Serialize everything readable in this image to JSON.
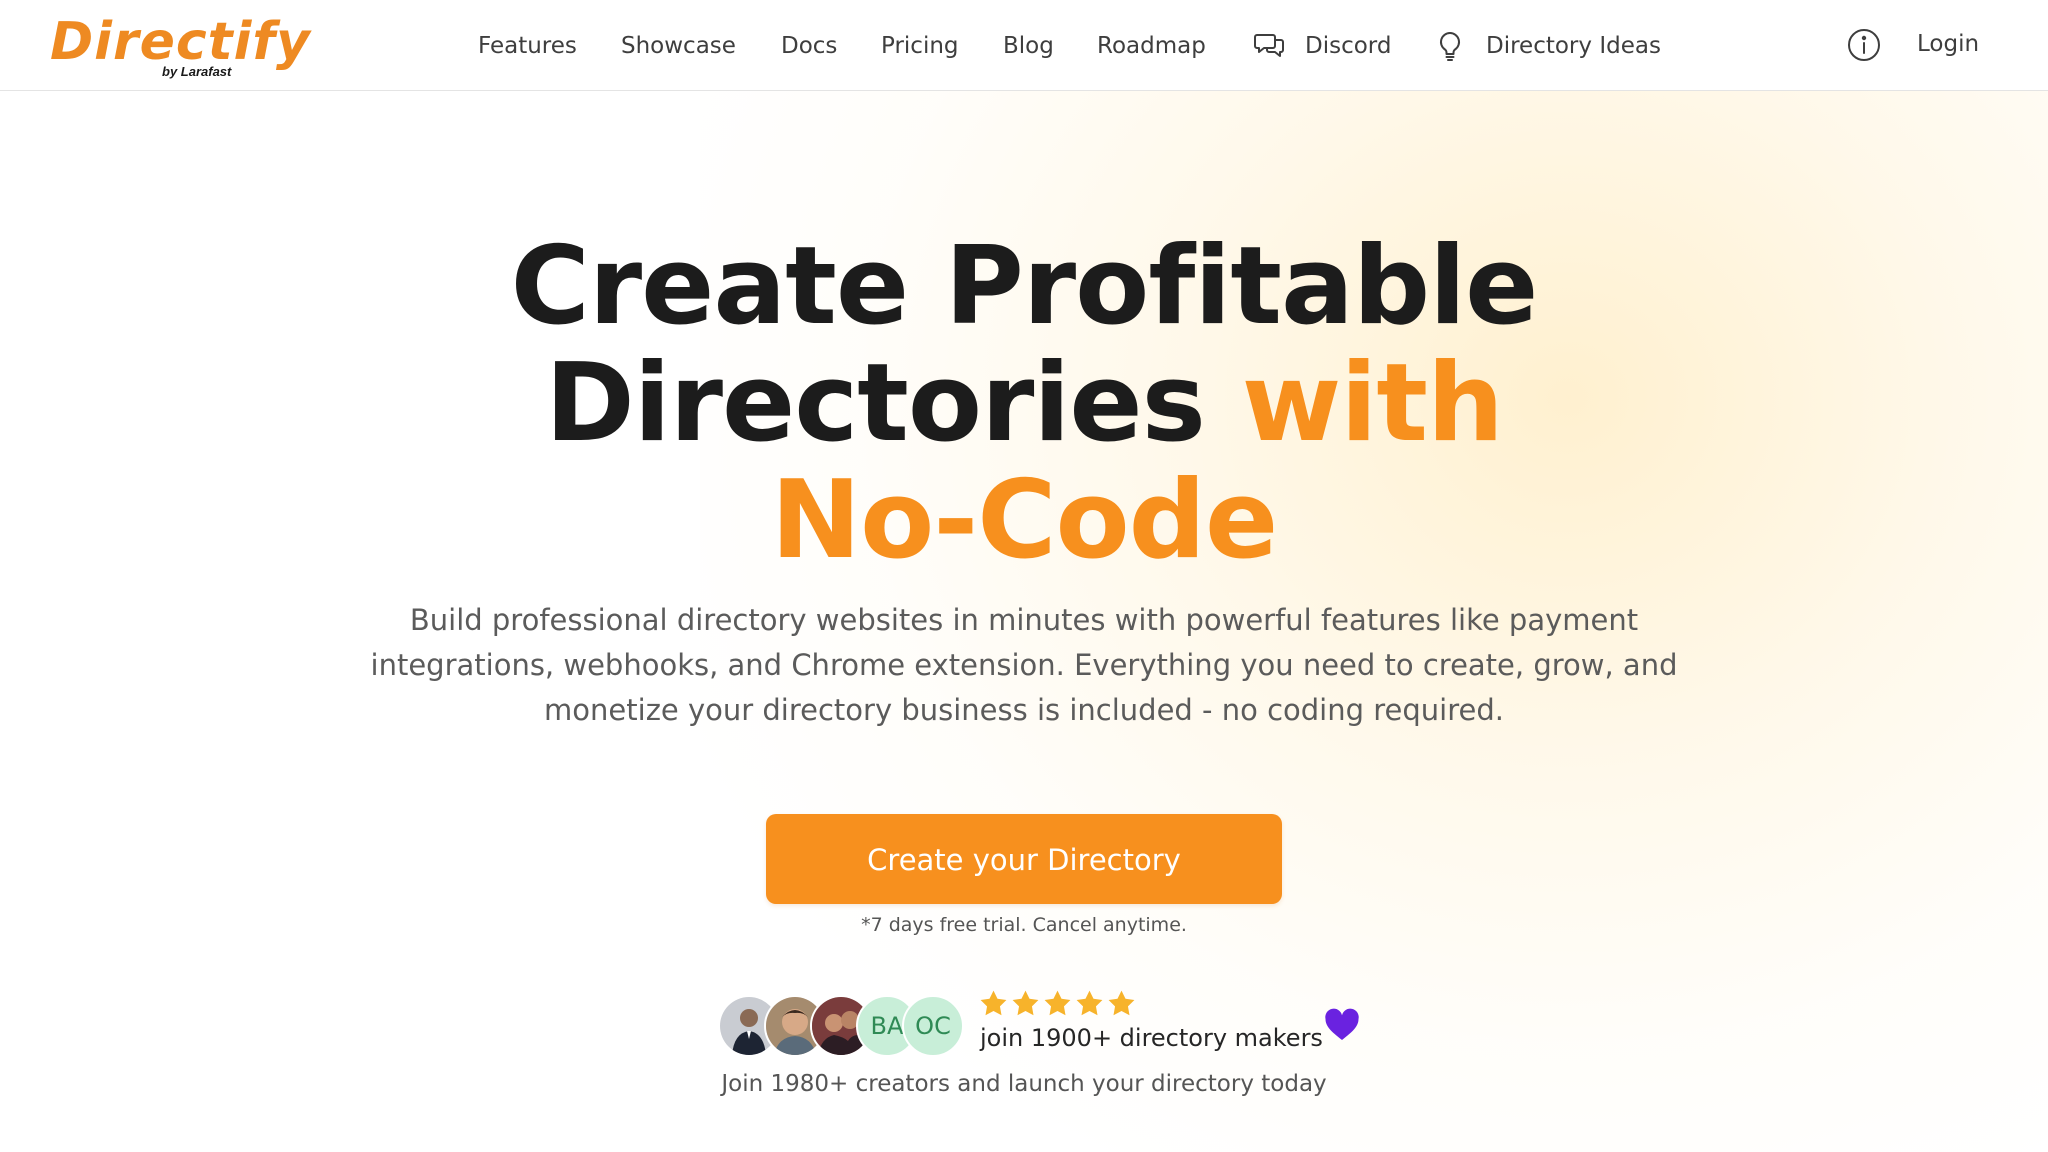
{
  "brand": {
    "name": "Directify",
    "tagline": "by Larafast",
    "accent_color": "#f7901e",
    "logo_color": "#ee8a22"
  },
  "nav": {
    "links": [
      {
        "label": "Features"
      },
      {
        "label": "Showcase"
      },
      {
        "label": "Docs"
      },
      {
        "label": "Pricing"
      },
      {
        "label": "Blog"
      },
      {
        "label": "Roadmap"
      },
      {
        "label": "Discord",
        "icon": "chat-bubbles-icon"
      },
      {
        "label": "Directory Ideas",
        "icon": "lightbulb-icon"
      }
    ],
    "info_icon": "info-icon",
    "login_label": "Login"
  },
  "hero": {
    "headline_line1": "Create Profitable",
    "headline_line2_dark": "Directories",
    "headline_line2_accent": "with",
    "headline_line3_accent": "No-Code",
    "subtext": "Build professional directory websites in minutes with powerful features like payment integrations, webhooks, and Chrome extension. Everything you need to create, grow, and monetize your directory business is included - no coding required.",
    "cta_label": "Create your Directory",
    "trial_note": "*7 days free trial. Cancel anytime."
  },
  "social_proof": {
    "avatars": [
      {
        "type": "photo",
        "icon": "user-photo-1"
      },
      {
        "type": "photo",
        "icon": "user-photo-2"
      },
      {
        "type": "photo",
        "icon": "user-photo-3"
      },
      {
        "type": "initials",
        "initials": "BA"
      },
      {
        "type": "initials",
        "initials": "OC"
      }
    ],
    "rating": 5,
    "star_color": "#f7b32b",
    "makers_text": "join 1900+ directory makers",
    "heart_color": "#6a22e0",
    "join_text": "Join 1980+ creators and launch your directory today"
  }
}
